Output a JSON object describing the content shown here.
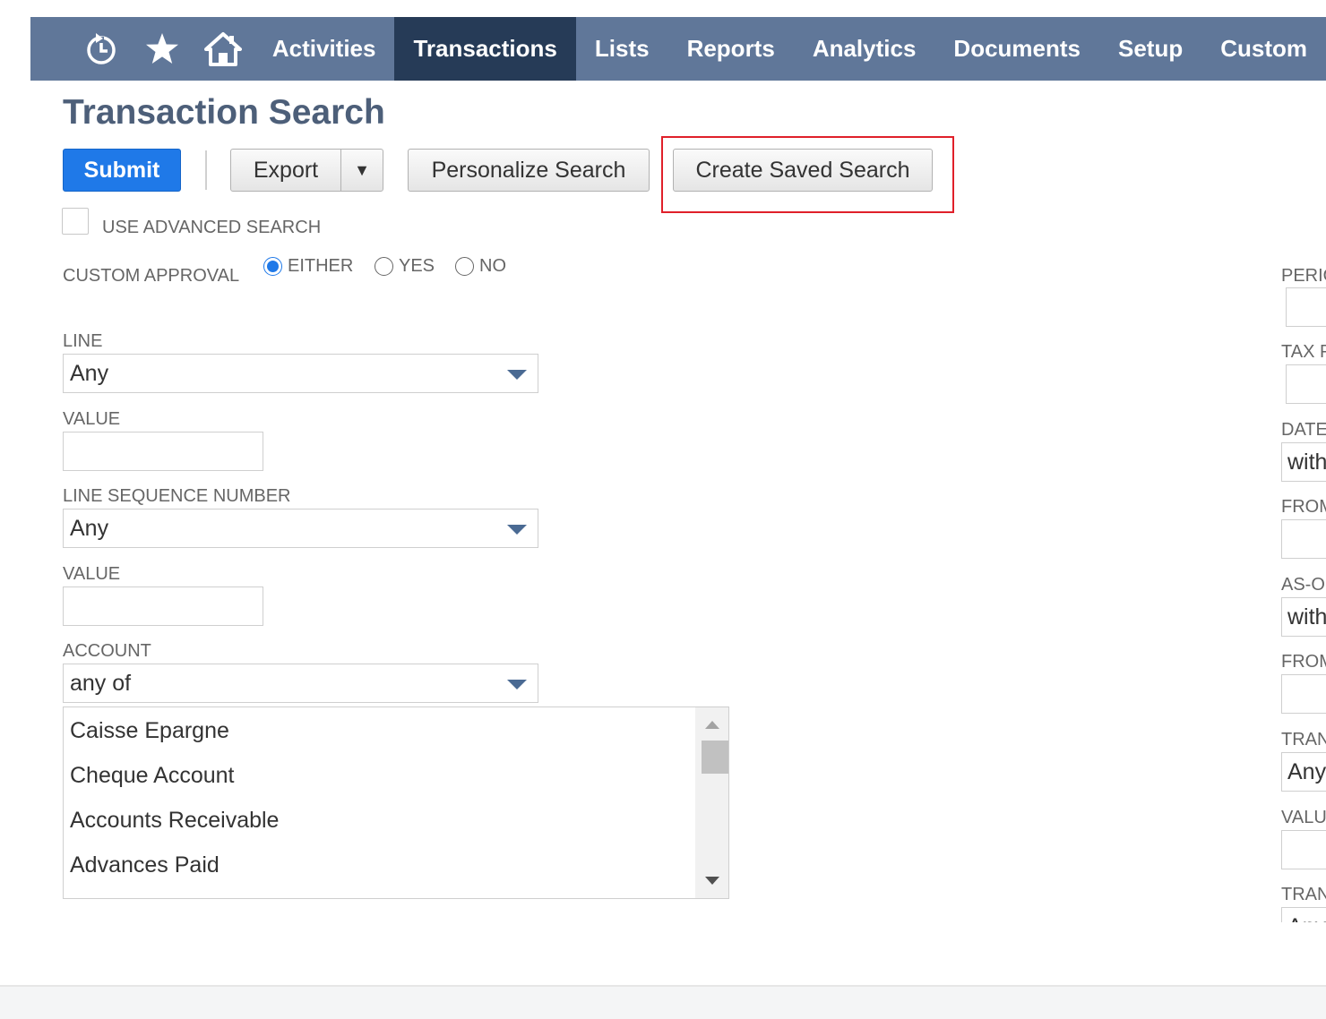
{
  "nav": {
    "icons": [
      "recent-history-icon",
      "star-icon",
      "home-icon"
    ],
    "tabs": [
      "Activities",
      "Transactions",
      "Lists",
      "Reports",
      "Analytics",
      "Documents",
      "Setup",
      "Custom"
    ],
    "active_tab": "Transactions"
  },
  "page": {
    "title": "Transaction Search"
  },
  "toolbar": {
    "submit": "Submit",
    "export": "Export",
    "export_dropdown": "▼",
    "personalize": "Personalize Search",
    "create_saved": "Create Saved Search"
  },
  "advanced": {
    "label": "USE ADVANCED SEARCH",
    "checked": false
  },
  "custom_approval": {
    "label": "CUSTOM APPROVAL",
    "options": [
      "EITHER",
      "YES",
      "NO"
    ],
    "selected": "EITHER"
  },
  "line": {
    "label": "LINE",
    "value": "Any"
  },
  "line_value": {
    "label": "VALUE",
    "value": ""
  },
  "line_seq": {
    "label": "LINE SEQUENCE NUMBER",
    "value": "Any"
  },
  "line_seq_value": {
    "label": "VALUE",
    "value": ""
  },
  "account": {
    "label": "ACCOUNT",
    "value": "any of",
    "options": [
      "Caisse Epargne",
      "Cheque Account",
      "Accounts Receivable",
      "Advances Paid"
    ]
  },
  "right_column": {
    "labels": [
      "PERIOD",
      "TAX PERIOD",
      "DATE",
      "FROM",
      "AS-OF",
      "FROM",
      "TRANSACTION",
      "VALUE",
      "TRANSACTION"
    ],
    "field_values": [
      "",
      "",
      "within",
      "",
      "within",
      "",
      "Any",
      "",
      "Any"
    ]
  },
  "colors": {
    "nav_bg": "#607799",
    "nav_active": "#263b57",
    "title": "#4d5f79",
    "submit_bg": "#1f79e8",
    "highlight": "#e0202a"
  }
}
